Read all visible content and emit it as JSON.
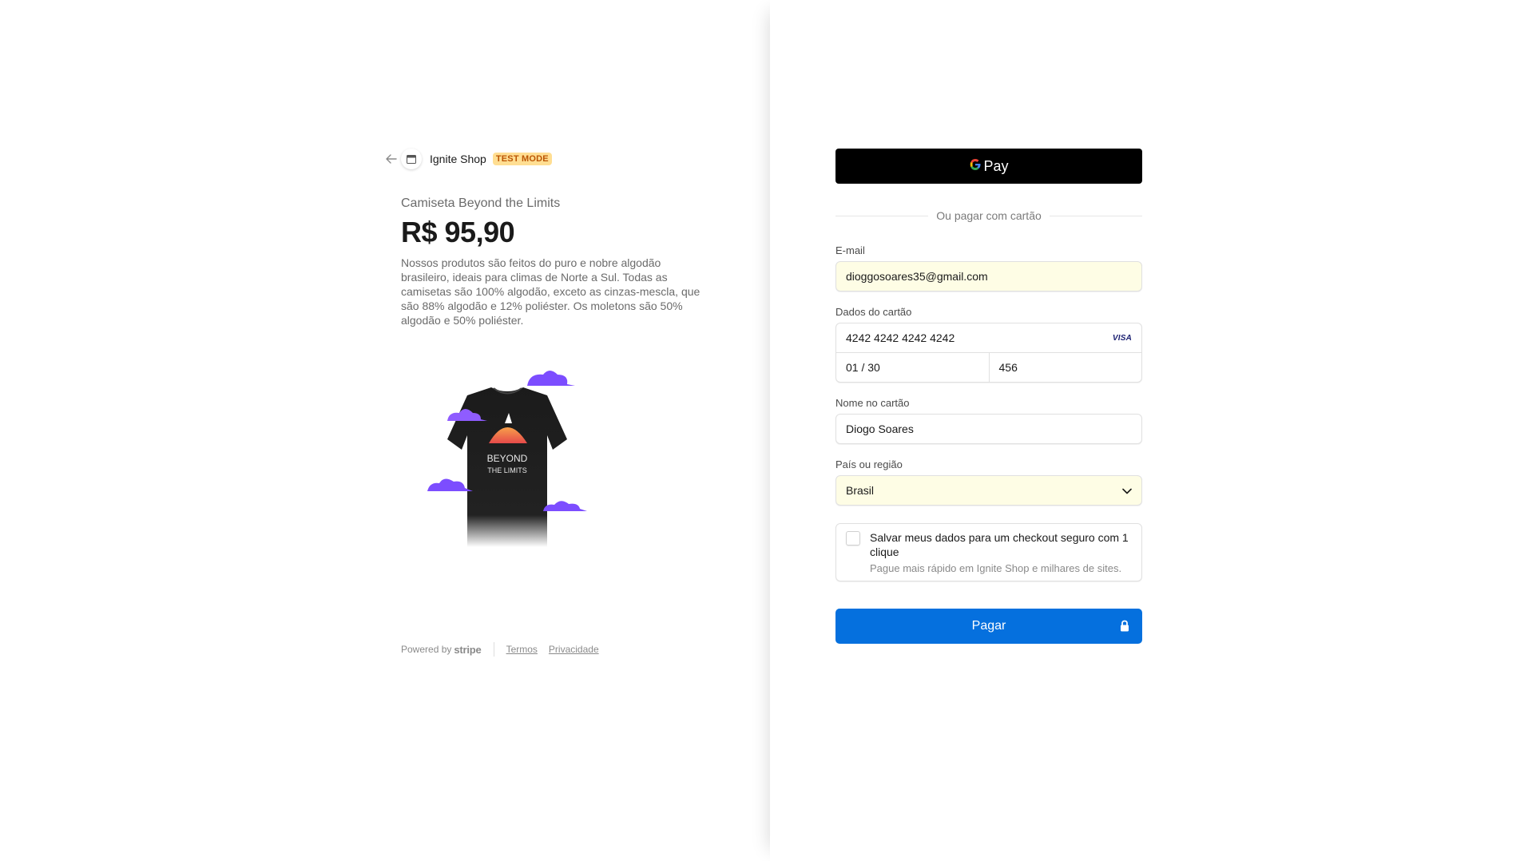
{
  "merchant": {
    "name": "Ignite Shop",
    "test_badge": "TEST MODE"
  },
  "product": {
    "name": "Camiseta Beyond the Limits",
    "price": "R$ 95,90",
    "description": "Nossos produtos são feitos do puro e nobre algodão brasileiro, ideais para climas de Norte a Sul. Todas as camisetas são 100% algodão, exceto as cinzas-mescla, que são 88% algodão e 12% poliéster. Os moletons são 50% algodão e 50% poliéster.",
    "image_text_line1": "BEYOND",
    "image_text_line2": "THE LIMITS"
  },
  "footer": {
    "powered_by": "Powered by",
    "stripe": "stripe",
    "terms": "Termos",
    "privacy": "Privacidade"
  },
  "gpay": {
    "label": "Pay"
  },
  "divider_text": "Ou pagar com cartão",
  "email": {
    "label": "E-mail",
    "value": "dioggosoares35@gmail.com"
  },
  "card": {
    "label": "Dados do cartão",
    "number": "4242 4242 4242 4242",
    "brand": "VISA",
    "expiry": "01 / 30",
    "cvc": "456"
  },
  "name_on_card": {
    "label": "Nome no cartão",
    "value": "Diogo Soares"
  },
  "country": {
    "label": "País ou região",
    "value": "Brasil"
  },
  "save": {
    "title": "Salvar meus dados para um checkout seguro com 1 clique",
    "subtitle": "Pague mais rápido em Ignite Shop e milhares de sites."
  },
  "pay_button": {
    "label": "Pagar"
  },
  "colors": {
    "pay_button": "#0570de",
    "autofill_background": "#fefde5",
    "test_badge_background": "#ffde92",
    "test_badge_text": "#bb5504"
  }
}
